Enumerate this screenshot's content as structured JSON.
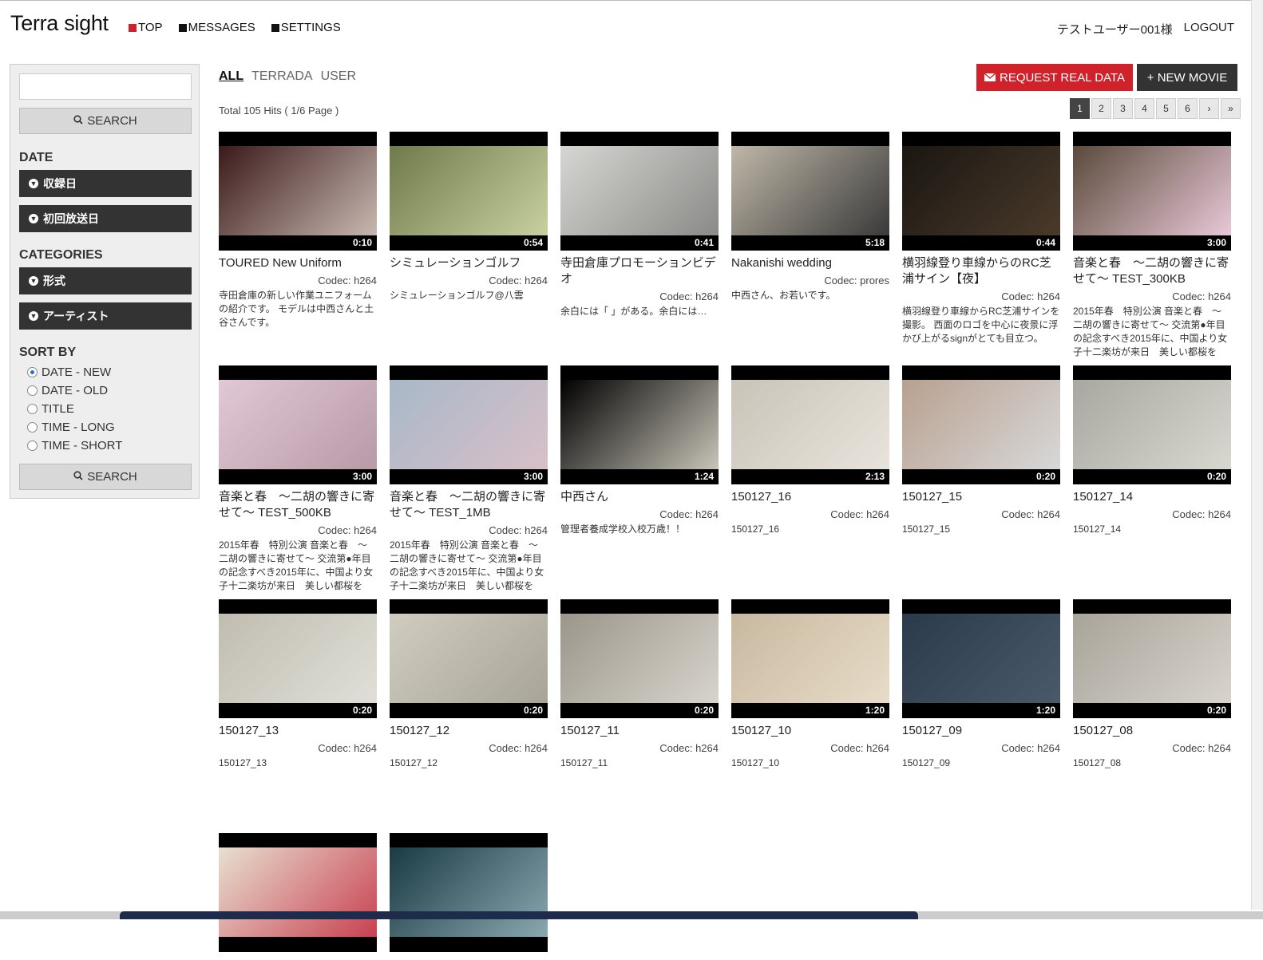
{
  "brand": "Terra sight",
  "nav": [
    {
      "label": "TOP",
      "color": "#d0222b"
    },
    {
      "label": "MESSAGES",
      "color": "#111111"
    },
    {
      "label": "SETTINGS",
      "color": "#111111"
    }
  ],
  "user": {
    "name": "テストユーザー001様",
    "logout": "LOGOUT"
  },
  "sidebar": {
    "search_value": "",
    "search_label": "SEARCH",
    "date_heading": "DATE",
    "date_buttons": [
      "収録日",
      "初回放送日"
    ],
    "categories_heading": "CATEGORIES",
    "category_buttons": [
      "形式",
      "アーティスト"
    ],
    "sort_heading": "SORT BY",
    "sort_options": [
      "DATE - NEW",
      "DATE - OLD",
      "TITLE",
      "TIME - LONG",
      "TIME - SHORT"
    ],
    "sort_selected": "DATE - NEW",
    "search2_label": "SEARCH"
  },
  "tabs": [
    {
      "label": "ALL",
      "active": true
    },
    {
      "label": "TERRADA",
      "active": false
    },
    {
      "label": "USER",
      "active": false
    }
  ],
  "hits": "Total 105 Hits ( 1/6 Page )",
  "request_button": "REQUEST REAL DATA",
  "new_movie_button": "+ NEW MOVIE",
  "pagination": [
    "1",
    "2",
    "3",
    "4",
    "5",
    "6",
    "›",
    "»"
  ],
  "current_page": "1",
  "videos": [
    {
      "title": "TOURED New Uniform",
      "duration": "0:10",
      "codec": "Codec: h264",
      "desc": "寺田倉庫の新しい作業ユニフォームの紹介です。 モデルは中西さんと土谷さんです。",
      "thumb": [
        "#3a1a1a",
        "#c8b8b0"
      ]
    },
    {
      "title": "シミュレーションゴルフ",
      "duration": "0:54",
      "codec": "Codec: h264",
      "desc": "シミュレーションゴルフ@八雲",
      "thumb": [
        "#6f7a4a",
        "#c8d0a0"
      ]
    },
    {
      "title": "寺田倉庫プロモーションビデオ",
      "duration": "0:41",
      "codec": "Codec: h264",
      "desc": "余白には「 」がある。余白には…",
      "thumb": [
        "#d6d6d2",
        "#8a8a88"
      ]
    },
    {
      "title": "Nakanishi wedding",
      "duration": "5:18",
      "codec": "Codec: prores",
      "desc": "中西さん、お若いです。",
      "thumb": [
        "#bfb7a8",
        "#3a3a3a"
      ]
    },
    {
      "title": "横羽線登り車線からのRC芝浦サイン【夜】",
      "duration": "0:44",
      "codec": "Codec: h264",
      "desc": "横羽線登り車線からRC芝浦サインを撮影。 西面のロゴを中心に夜景に浮かび上がるsignがとても目立つ。",
      "thumb": [
        "#1a1612",
        "#4a3a2a"
      ]
    },
    {
      "title": "音楽と春　〜二胡の響きに寄せて〜 TEST_300KB",
      "duration": "3:00",
      "codec": "Codec: h264",
      "desc": "2015年春　特別公演 音楽と春　〜二胡の響きに寄せて〜 交流第●年目の記念すべき2015年に、中国より女子十二楽坊が来日　美しい都桜を",
      "thumb": [
        "#5a4a3a",
        "#e8c8d8"
      ]
    },
    {
      "title": "音楽と春　〜二胡の響きに寄せて〜 TEST_500KB",
      "duration": "3:00",
      "codec": "Codec: h264",
      "desc": "2015年春　特別公演 音楽と春　〜二胡の響きに寄せて〜 交流第●年目の記念すべき2015年に、中国より女子十二楽坊が来日　美しい都桜を",
      "thumb": [
        "#e0c8d4",
        "#b89aa8"
      ]
    },
    {
      "title": "音楽と春　〜二胡の響きに寄せて〜 TEST_1MB",
      "duration": "3:00",
      "codec": "Codec: h264",
      "desc": "2015年春　特別公演 音楽と春　〜二胡の響きに寄せて〜 交流第●年目の記念すべき2015年に、中国より女子十二楽坊が来日　美しい都桜を",
      "thumb": [
        "#a8b8c8",
        "#d8c0c8"
      ]
    },
    {
      "title": "中西さん",
      "duration": "1:24",
      "codec": "Codec: h264",
      "desc": "管理者養成学校入校万歳！！",
      "thumb": [
        "#000000",
        "#c8c4b8"
      ]
    },
    {
      "title": "150127_16",
      "duration": "2:13",
      "codec": "Codec: h264",
      "desc": "150127_16",
      "thumb": [
        "#c8c4b8",
        "#e8e4dc"
      ]
    },
    {
      "title": "150127_15",
      "duration": "0:20",
      "codec": "Codec: h264",
      "desc": "150127_15",
      "thumb": [
        "#b8a090",
        "#d8d8d8"
      ]
    },
    {
      "title": "150127_14",
      "duration": "0:20",
      "codec": "Codec: h264",
      "desc": "150127_14",
      "thumb": [
        "#a8a8a0",
        "#d8d8d0"
      ]
    },
    {
      "title": "150127_13",
      "duration": "0:20",
      "codec": "Codec: h264",
      "desc": "150127_13",
      "thumb": [
        "#c0bcb0",
        "#e0e0d8"
      ]
    },
    {
      "title": "150127_12",
      "duration": "0:20",
      "codec": "Codec: h264",
      "desc": "150127_12",
      "thumb": [
        "#d0ccc0",
        "#a8a498"
      ]
    },
    {
      "title": "150127_11",
      "duration": "0:20",
      "codec": "Codec: h264",
      "desc": "150127_11",
      "thumb": [
        "#9a968a",
        "#d8d4cc"
      ]
    },
    {
      "title": "150127_10",
      "duration": "1:20",
      "codec": "Codec: h264",
      "desc": "150127_10",
      "thumb": [
        "#c8b8a0",
        "#e8dcc8"
      ]
    },
    {
      "title": "150127_09",
      "duration": "1:20",
      "codec": "Codec: h264",
      "desc": "150127_09",
      "thumb": [
        "#2a3a4a",
        "#4a5a6a"
      ]
    },
    {
      "title": "150127_08",
      "duration": "0:20",
      "codec": "Codec: h264",
      "desc": "150127_08",
      "thumb": [
        "#a8a49a",
        "#d8d4cc"
      ]
    },
    {
      "title": "",
      "duration": "",
      "codec": "",
      "desc": "",
      "thumb": [
        "#e8e0d0",
        "#c84050"
      ]
    },
    {
      "title": "",
      "duration": "",
      "codec": "",
      "desc": "",
      "thumb": [
        "#1a3a44",
        "#8aa8b0"
      ]
    }
  ]
}
